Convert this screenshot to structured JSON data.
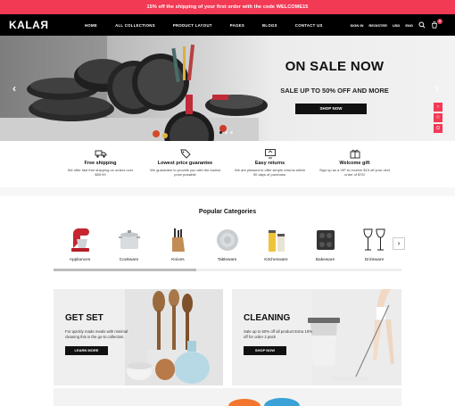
{
  "promo": {
    "text": "15% off the shipping of your first order with the code WELCOME15"
  },
  "nav": {
    "logo": "KALAЯ",
    "menu": [
      "HOME",
      "ALL COLLECTIONS",
      "PRODUCT LAYOUT",
      "PAGES",
      "BLOGS",
      "CONTACT US"
    ],
    "sign_in": "SIGN IN",
    "register": "REGISTER",
    "currency": "USD",
    "language": "ENG",
    "cart_count": "0"
  },
  "hero": {
    "title": "ON SALE NOW",
    "subtitle": "SALE UP TO 50% OFF AND MORE",
    "button": "SHOP NOW",
    "prev": "‹",
    "next": "›"
  },
  "features": [
    {
      "title": "Free shipping",
      "desc": "We offer fast free shipping on orders over $59.99",
      "icon": "truck-icon"
    },
    {
      "title": "Lowest price guarantee",
      "desc": "We guarantee to provide you with the lowest price possible",
      "icon": "price-tag-icon"
    },
    {
      "title": "Easy returns",
      "desc": "We are pleased to offer simple returns within 90 days of purchase.",
      "icon": "monitor-return-icon"
    },
    {
      "title": "Welcome gift",
      "desc": "Sign up as a VIP to receive $15 off your next order of $75!",
      "icon": "gift-icon"
    }
  ],
  "categories": {
    "heading": "Popular Categories",
    "items": [
      "Appliances",
      "Cookware",
      "Knives",
      "Tableware",
      "Kitchenware",
      "Bakeware",
      "Drinkware"
    ],
    "next": "›"
  },
  "banners": [
    {
      "title": "GET SET",
      "desc": "For quickly made meals with minimal cleaning this is the go-to collection.",
      "button": "LEARN MORE"
    },
    {
      "title": "CLEANING",
      "desc": "Sale up to 50% off all product Extra 10% off for order 2 pack",
      "button": "SHOP NOW"
    }
  ],
  "colors": {
    "accent": "#f23a55",
    "nav_bg": "#000000",
    "button": "#111111"
  }
}
